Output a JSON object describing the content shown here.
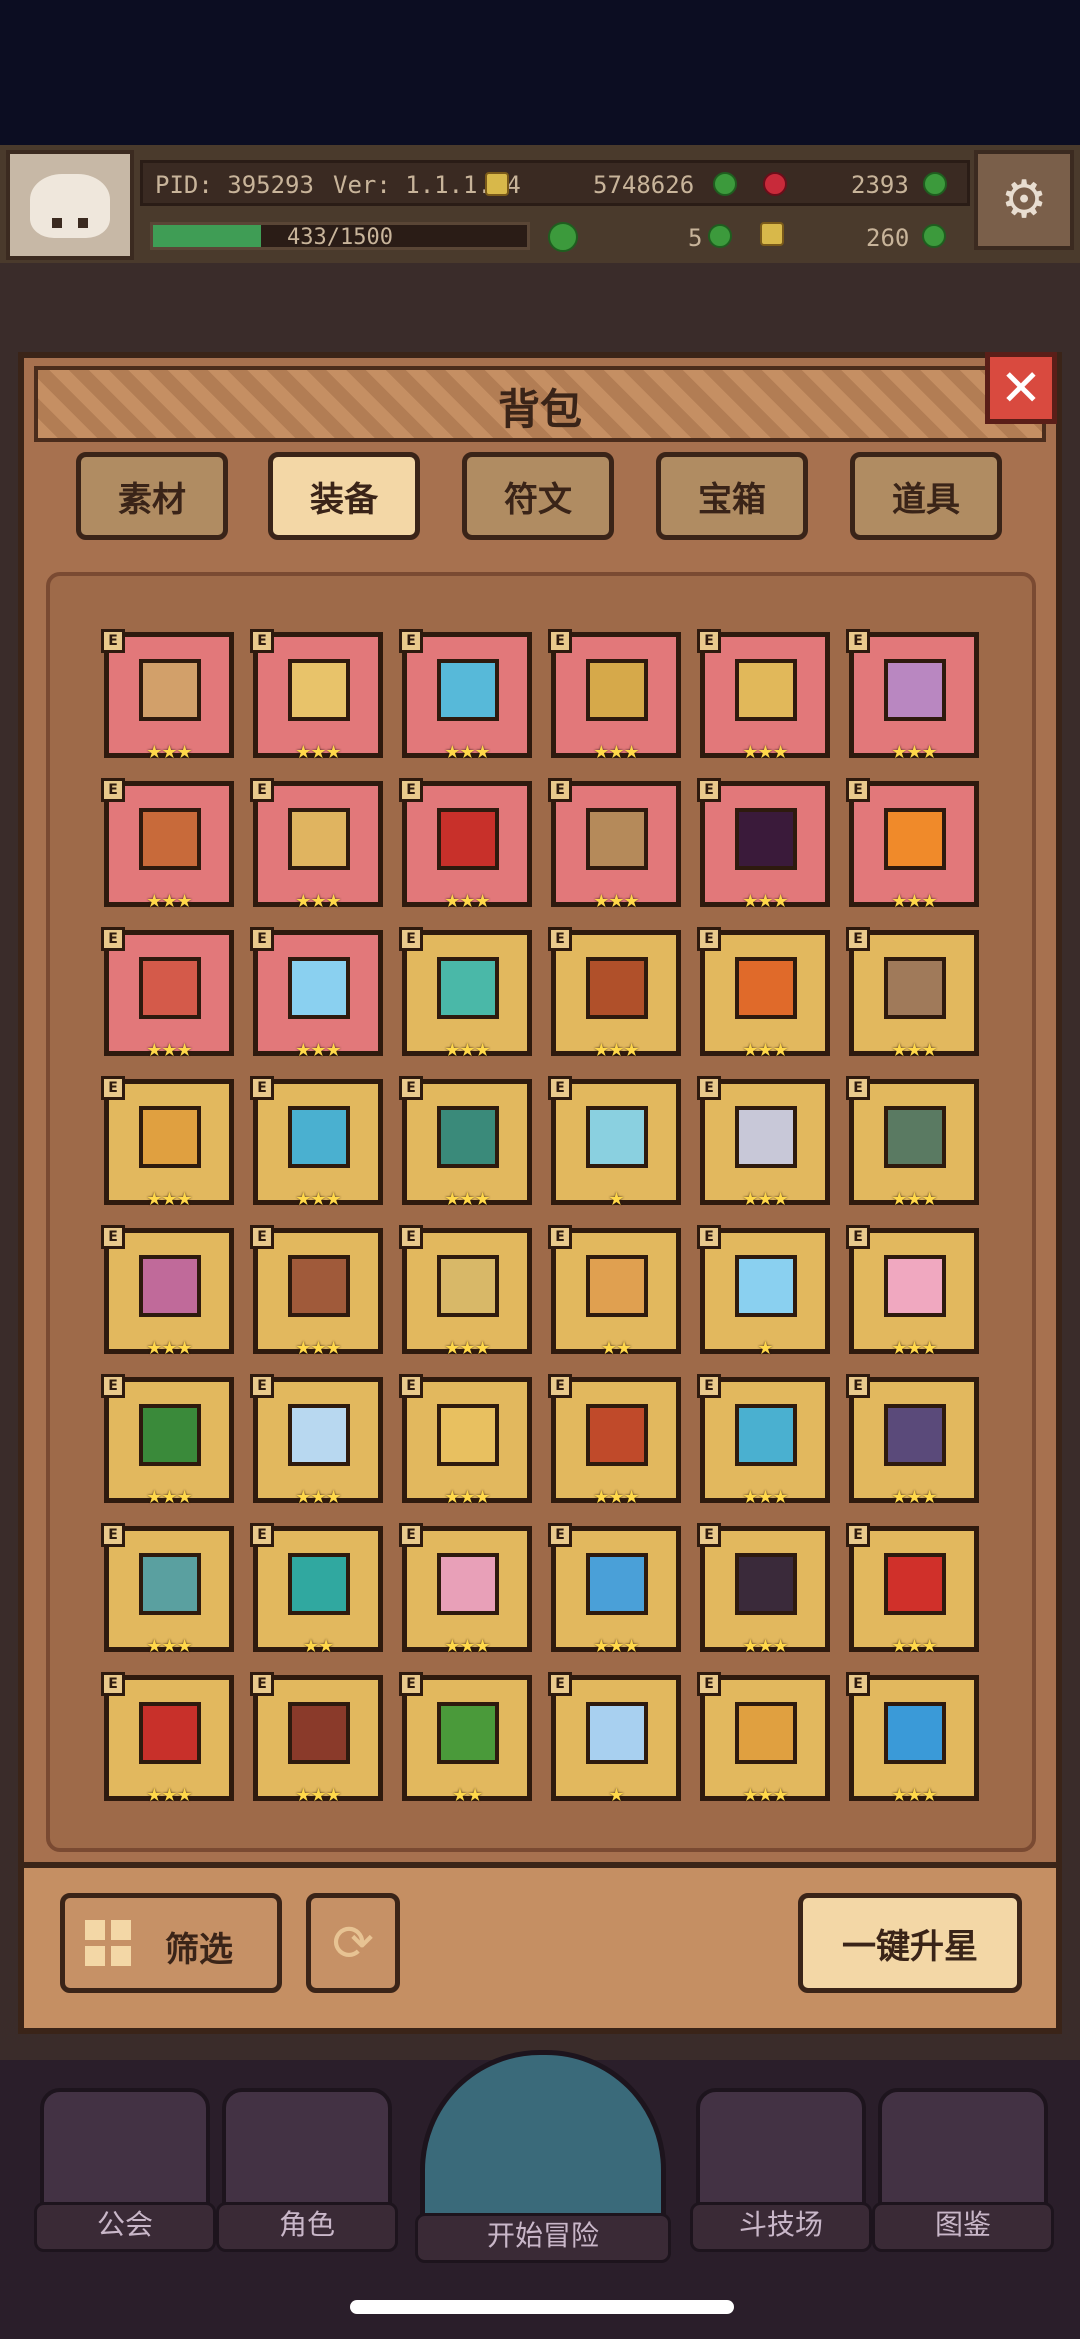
{
  "hud": {
    "pid": "PID: 395293",
    "version": "Ver: 1.1.1.14",
    "gold": "5748626",
    "ruby": "2393",
    "xp": "433/1500",
    "xp_fraction": 0.289,
    "clover": "5",
    "key": "260"
  },
  "panel": {
    "title": "背包",
    "tabs": [
      "素材",
      "装备",
      "符文",
      "宝箱",
      "道具"
    ],
    "active_tab": "装备",
    "tag_letter": "E"
  },
  "items": [
    {
      "bg": "red",
      "color": "#d2a06a",
      "stars": "★★★"
    },
    {
      "bg": "red",
      "color": "#e8c36a",
      "stars": "★★★"
    },
    {
      "bg": "red",
      "color": "#57b9d9",
      "stars": "★★★"
    },
    {
      "bg": "red",
      "color": "#d6a94a",
      "stars": "★★★"
    },
    {
      "bg": "red",
      "color": "#e1b85a",
      "stars": "★★★"
    },
    {
      "bg": "red",
      "color": "#b987c1",
      "stars": "★★★"
    },
    {
      "bg": "red",
      "color": "#c86a3a",
      "stars": "★★★"
    },
    {
      "bg": "red",
      "color": "#e0b460",
      "stars": "★★★"
    },
    {
      "bg": "red",
      "color": "#c8302a",
      "stars": "★★★"
    },
    {
      "bg": "red",
      "color": "#b58a5a",
      "stars": "★★★"
    },
    {
      "bg": "red",
      "color": "#3a1a3a",
      "stars": "★★★"
    },
    {
      "bg": "red",
      "color": "#f08a2a",
      "stars": "★★★"
    },
    {
      "bg": "red",
      "color": "#d45a4a",
      "stars": "★★★"
    },
    {
      "bg": "red",
      "color": "#8ad0f0",
      "stars": "★★★"
    },
    {
      "bg": "gold",
      "color": "#4ab8a8",
      "stars": "★★★"
    },
    {
      "bg": "gold",
      "color": "#b0502a",
      "stars": "★★★"
    },
    {
      "bg": "gold",
      "color": "#e06a2a",
      "stars": "★★★"
    },
    {
      "bg": "gold",
      "color": "#a07a5a",
      "stars": "★★★"
    },
    {
      "bg": "gold",
      "color": "#e0a040",
      "stars": "★★★"
    },
    {
      "bg": "gold",
      "color": "#4ab0d0",
      "stars": "★★★"
    },
    {
      "bg": "gold",
      "color": "#3a8a7a",
      "stars": "★★★"
    },
    {
      "bg": "gold",
      "color": "#8ad0e0",
      "stars": "★"
    },
    {
      "bg": "gold",
      "color": "#c8c8d8",
      "stars": "★★★"
    },
    {
      "bg": "gold",
      "color": "#5a7a62",
      "stars": "★★★"
    },
    {
      "bg": "gold",
      "color": "#c06a9a",
      "stars": "★★★"
    },
    {
      "bg": "gold",
      "color": "#a05a3a",
      "stars": "★★★"
    },
    {
      "bg": "gold",
      "color": "#d8b868",
      "stars": "★★★"
    },
    {
      "bg": "gold",
      "color": "#e0a050",
      "stars": "★★"
    },
    {
      "bg": "gold",
      "color": "#8ad0f0",
      "stars": "★"
    },
    {
      "bg": "gold",
      "color": "#f0a8c0",
      "stars": "★★★"
    },
    {
      "bg": "gold",
      "color": "#3a8a3a",
      "stars": "★★★"
    },
    {
      "bg": "gold",
      "color": "#b8d8f0",
      "stars": "★★★"
    },
    {
      "bg": "gold",
      "color": "#e8c060",
      "stars": "★★★"
    },
    {
      "bg": "gold",
      "color": "#c04a2a",
      "stars": "★★★"
    },
    {
      "bg": "gold",
      "color": "#4ab0d0",
      "stars": "★★★"
    },
    {
      "bg": "gold",
      "color": "#5a4a7a",
      "stars": "★★★"
    },
    {
      "bg": "gold",
      "color": "#5aa0a0",
      "stars": "★★★"
    },
    {
      "bg": "gold",
      "color": "#30a8a0",
      "stars": "★★"
    },
    {
      "bg": "gold",
      "color": "#e8a0b8",
      "stars": "★★★"
    },
    {
      "bg": "gold",
      "color": "#4aa0d8",
      "stars": "★★★"
    },
    {
      "bg": "gold",
      "color": "#3a2a3a",
      "stars": "★★★"
    },
    {
      "bg": "gold",
      "color": "#d0302a",
      "stars": "★★★"
    },
    {
      "bg": "gold",
      "color": "#c8302a",
      "stars": "★★★"
    },
    {
      "bg": "gold",
      "color": "#8a3a2a",
      "stars": "★★★"
    },
    {
      "bg": "gold",
      "color": "#4a9a3a",
      "stars": "★★"
    },
    {
      "bg": "gold",
      "color": "#a8d0f0",
      "stars": "★"
    },
    {
      "bg": "gold",
      "color": "#e0a040",
      "stars": "★★★"
    },
    {
      "bg": "gold",
      "color": "#3a9ad8",
      "stars": "★★★"
    }
  ],
  "footer": {
    "filter_label": "筛选",
    "refresh_symbol": "⟳",
    "star_all_label": "一键升星"
  },
  "nav": {
    "guild": "公会",
    "character": "角色",
    "adventure": "开始冒险",
    "arena": "斗技场",
    "codex": "图鉴"
  }
}
